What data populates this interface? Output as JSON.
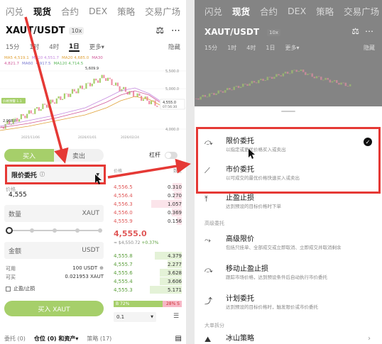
{
  "nav": [
    "闪兑",
    "现货",
    "合约",
    "DEX",
    "策略",
    "交易广场"
  ],
  "nav_active": 1,
  "pair": "XAUT/USDT",
  "leverage": "10x",
  "timeframes": [
    "15分",
    "1时",
    "4时",
    "1日",
    "更多▾"
  ],
  "timeframe_active": 3,
  "hide_label": "隐藏",
  "ma_lines": [
    {
      "text": "MA5 4,519.1",
      "color": "#e0a23a"
    },
    {
      "text": "MA10 4,551.7",
      "color": "#c58adf"
    },
    {
      "text": "MA20 4,685.0",
      "color": "#e0a23a"
    },
    {
      "text": "MA30 4,821.7",
      "color": "#d05a9a"
    },
    {
      "text": "MA60",
      "color": "#7a7ad0"
    },
    {
      "text": "4,917.5",
      "color": "#7a7ad0"
    },
    {
      "text": "MA120 4,714.5",
      "color": "#5cb85c"
    }
  ],
  "chart_labels": {
    "high": "5,609.9",
    "y_ticks": [
      "5,500.0",
      "5,000.0",
      "4,500.0",
      "4,000.0"
    ],
    "last": "4,555.0",
    "countdown": "07:56:30",
    "low": "2,968.8",
    "dates": [
      "2025/11/06",
      "2026/01/01",
      "2026/02/24"
    ],
    "avg_badge": "价格预警 1.1"
  },
  "form": {
    "buy": "买入",
    "sell": "卖出",
    "margin": "杠杆",
    "order_type": "限价委托",
    "price_label": "价格",
    "price_value": "4,555",
    "qty_placeholder": "数量",
    "qty_unit": "XAUT",
    "amount_placeholder": "金额",
    "amount_unit": "USDT",
    "available_label": "可用",
    "available_value": "100 USDT",
    "buyable_label": "可买",
    "buyable_value": "0.021953 XAUT",
    "tpsl": "止盈/止损",
    "buy_button": "买入 XAUT"
  },
  "orderbook": {
    "head_price": "价格",
    "head_qty": "数量",
    "asks": [
      {
        "p": "4,556.5",
        "q": "0.310",
        "depth": 0.28
      },
      {
        "p": "4,556.4",
        "q": "0.270",
        "depth": 0.25
      },
      {
        "p": "4,556.3",
        "q": "1.057",
        "depth": 0.95
      },
      {
        "p": "4,556.0",
        "q": "0.369",
        "depth": 0.32
      },
      {
        "p": "4,555.9",
        "q": "0.156",
        "depth": 0.16
      }
    ],
    "mid": "4,555.0",
    "mid_usd": "≈ $4,550.72",
    "mid_change": "+0.37%",
    "bids": [
      {
        "p": "4,555.8",
        "q": "4.379",
        "depth": 0.85
      },
      {
        "p": "4,555.7",
        "q": "2.277",
        "depth": 0.45
      },
      {
        "p": "4,555.6",
        "q": "3.628",
        "depth": 0.7
      },
      {
        "p": "4,555.4",
        "q": "3.606",
        "depth": 0.7
      },
      {
        "p": "4,555.3",
        "q": "5.171",
        "depth": 1.0
      }
    ],
    "buy_ratio": "B 72%",
    "sell_ratio": "28% S",
    "buy_pct": 72,
    "precision": "0.1"
  },
  "bottom_tabs": [
    "委托 (0)",
    "仓位 (0) 和资产▾",
    "策略 (17)"
  ],
  "bottom_active": 1,
  "sheet": {
    "options": [
      {
        "title": "限价委托",
        "desc": "以指定或更优价格买入或卖出",
        "icon": "limit-order-icon",
        "checked": true
      },
      {
        "title": "市价委托",
        "desc": "以可成交的最优价格快速买入或卖出",
        "icon": "market-order-icon"
      },
      {
        "title": "止盈止损",
        "desc": "达到预设的目标价格时下单",
        "icon": "tpsl-icon"
      }
    ],
    "advanced_section": "高级委托",
    "advanced": [
      {
        "title": "高级限价",
        "desc": "包括只挂单、全部成交或立即取消、立即成交并取消剩余",
        "icon": "advanced-limit-icon"
      },
      {
        "title": "移动止盈止损",
        "desc": "跟踪市场价格，达到预设条件后自动执行市价委托",
        "icon": "trailing-stop-icon"
      },
      {
        "title": "计划委托",
        "desc": "达到预设的目标价格时，触发限价或市价委托",
        "icon": "trigger-order-icon"
      }
    ],
    "split_section": "大单拆分",
    "split": [
      {
        "title": "冰山策略",
        "icon": "iceberg-icon"
      }
    ]
  }
}
